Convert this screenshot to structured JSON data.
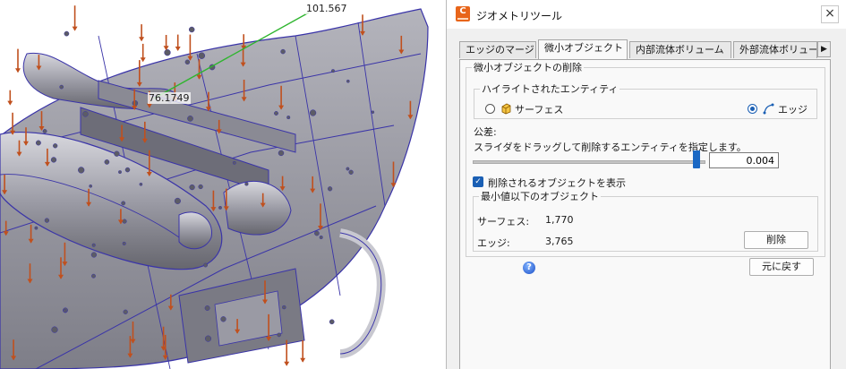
{
  "viewport": {
    "dimensions": [
      "101.567",
      "76.1749"
    ]
  },
  "dialog": {
    "title": "ジオメトリツール",
    "icon": "app-logo-icon",
    "tabs": [
      {
        "label": "エッジのマージ",
        "active": false
      },
      {
        "label": "微小オブジェクト",
        "active": true
      },
      {
        "label": "内部流体ボリューム",
        "active": false
      },
      {
        "label": "外部流体ボリュー",
        "active": false
      }
    ],
    "group_title": "微小オブジェクトの削除",
    "highlight": {
      "title": "ハイライトされたエンティティ",
      "surface_label": "サーフェス",
      "edge_label": "エッジ",
      "selected": "エッジ"
    },
    "tolerance": {
      "label": "公差:",
      "hint": "スライダをドラッグして削除するエンティティを指定します。",
      "value": "0.004",
      "slider_level_percent": 97
    },
    "show_deleted": {
      "label": "削除されるオブジェクトを表示",
      "checked": true
    },
    "below_min": {
      "title": "最小値以下のオブジェクト",
      "rows": [
        {
          "label": "サーフェス:",
          "value": "1,770"
        },
        {
          "label": "エッジ:",
          "value": "3,765"
        }
      ],
      "delete_label": "削除"
    },
    "undo_label": "元に戻す"
  }
}
